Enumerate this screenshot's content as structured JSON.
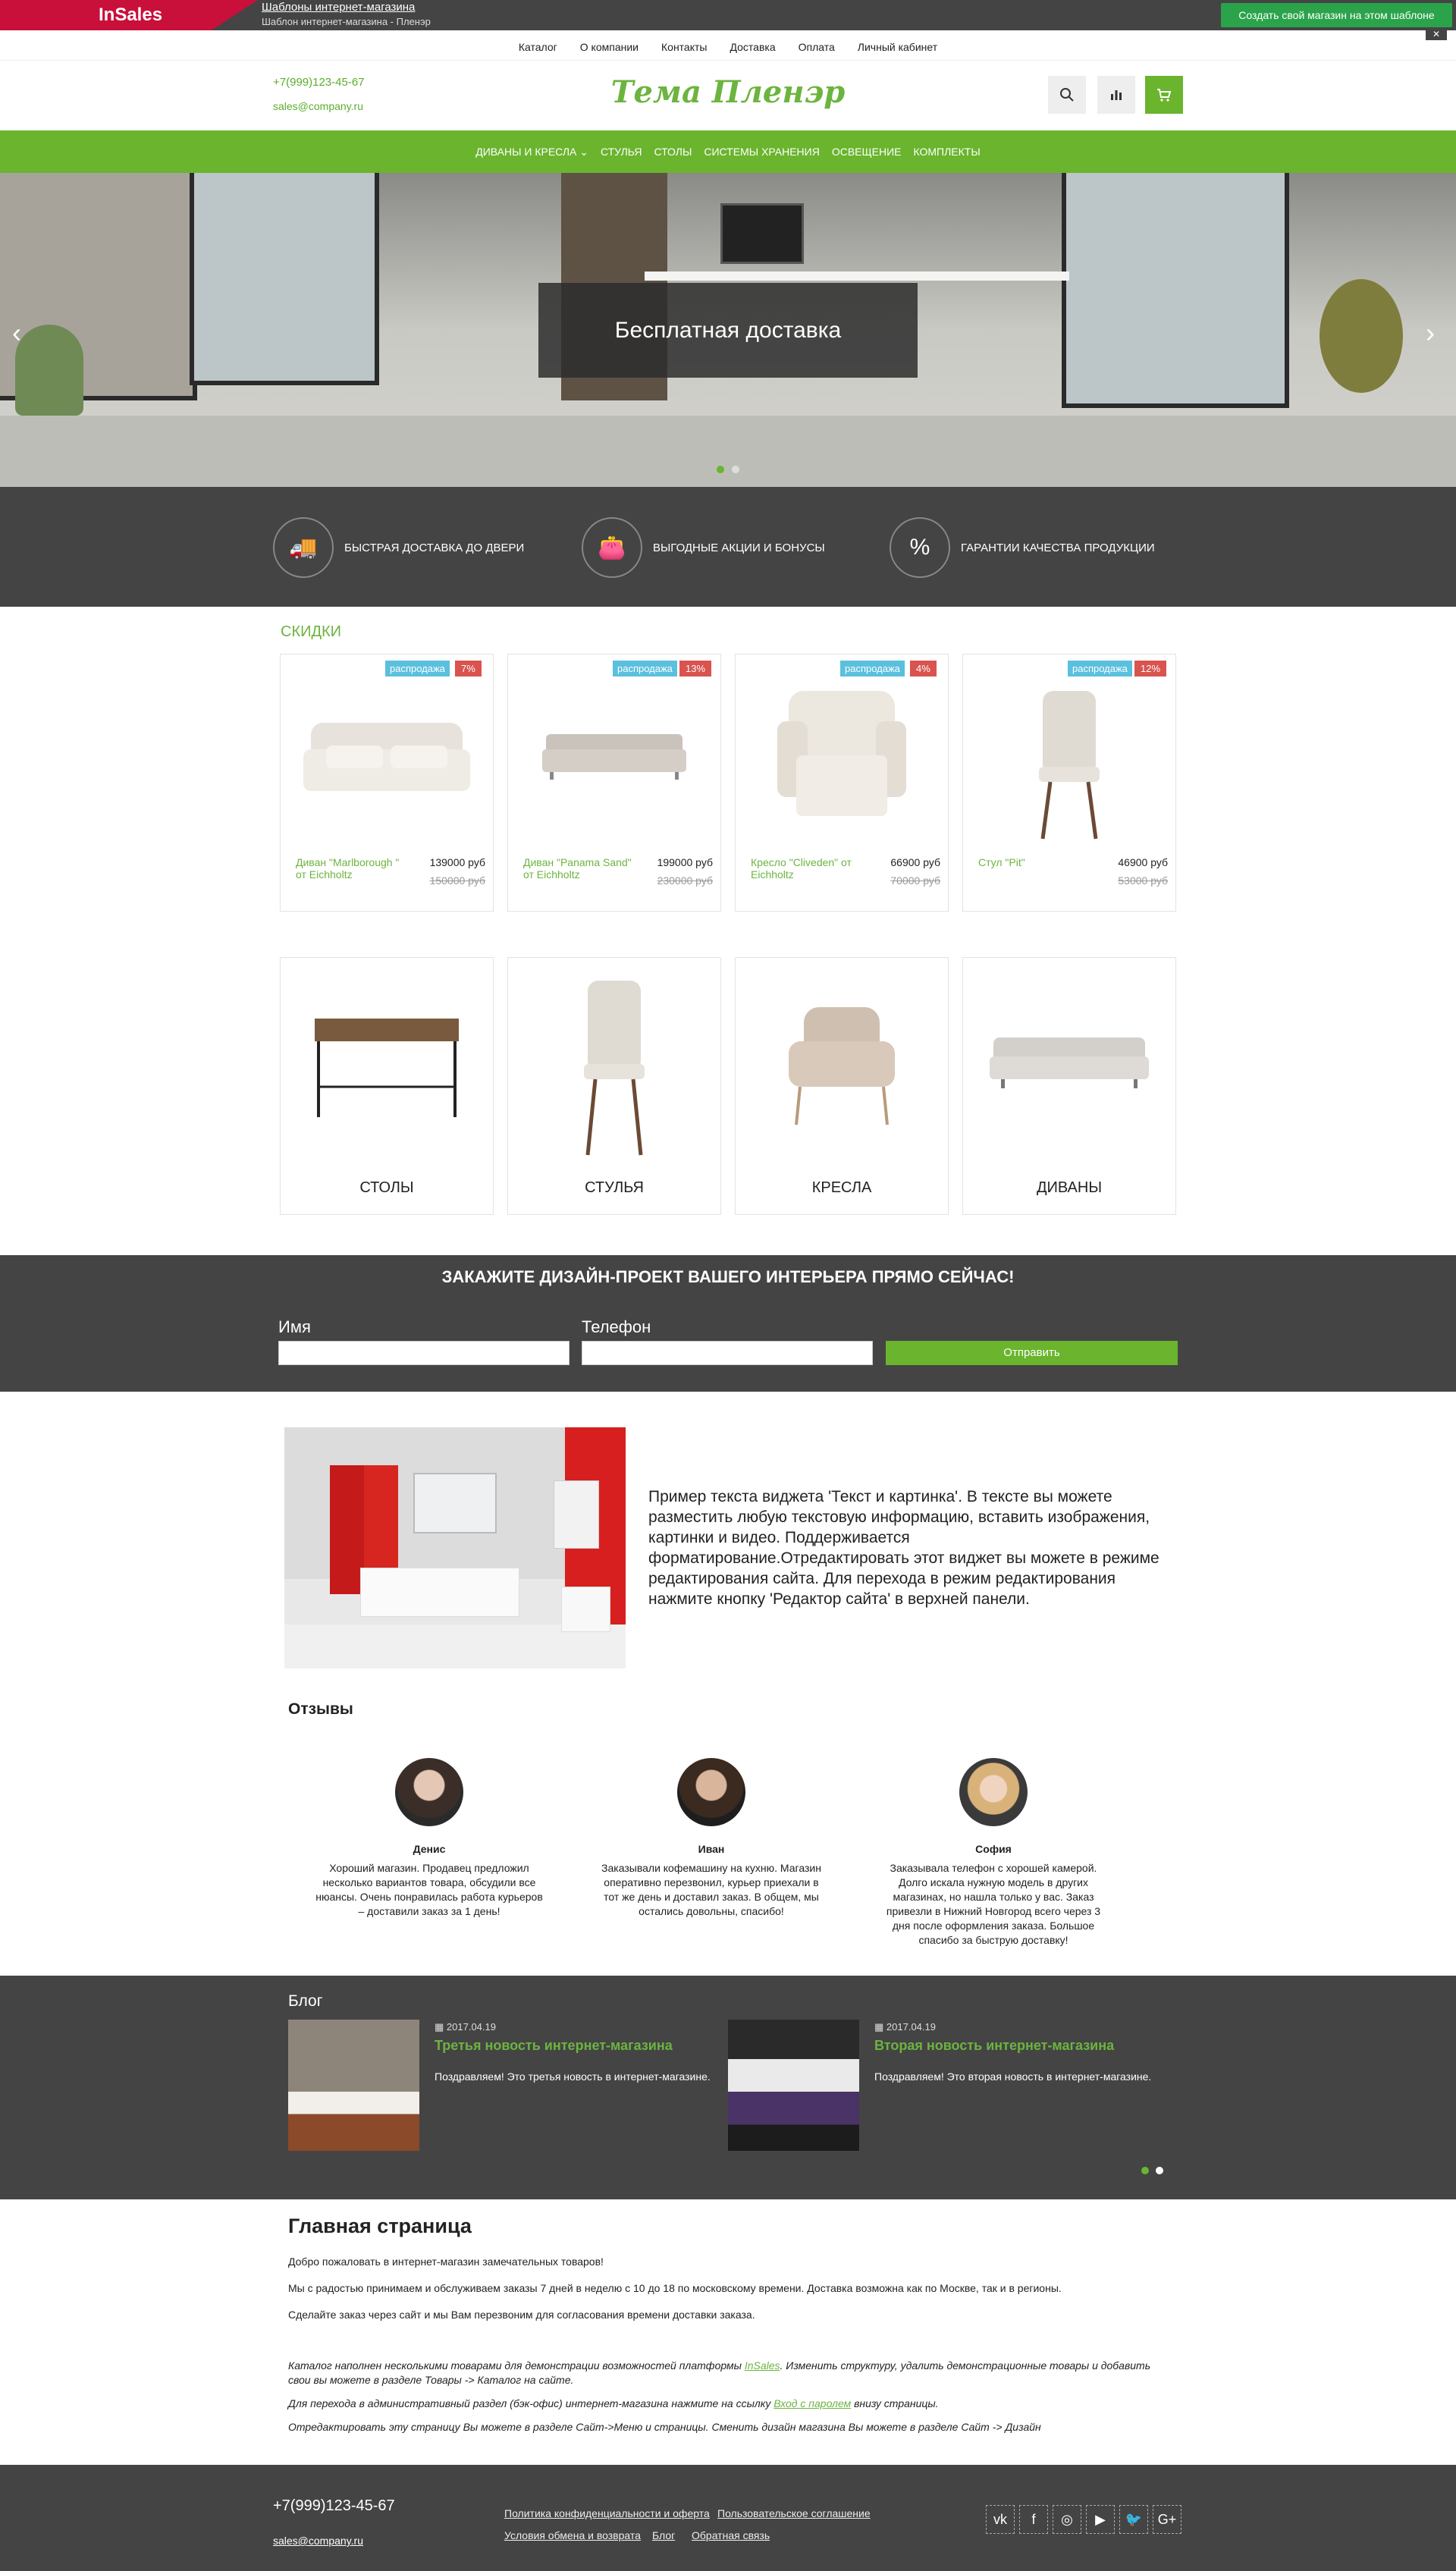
{
  "topbar": {
    "brand": "InSales",
    "link": "Шаблоны интернет-магазина",
    "subtitle": "Шаблон интернет-магазина - Пленэр",
    "create_btn": "Создать свой магазин на этом шаблоне",
    "close": "✕"
  },
  "topnav": [
    "Каталог",
    "О компании",
    "Контакты",
    "Доставка",
    "Оплата",
    "Личный кабинет"
  ],
  "header": {
    "phone": "+7(999)123-45-67",
    "email": "sales@company.ru",
    "logo": "Тема Пленэр"
  },
  "mainnav": [
    "ДИВАНЫ И КРЕСЛА",
    "СТУЛЬЯ",
    "СТОЛЫ",
    "СИСТЕМЫ ХРАНЕНИЯ",
    "ОСВЕЩЕНИЕ",
    "КОМПЛЕКТЫ"
  ],
  "slider": {
    "banner": "Бесплатная доставка"
  },
  "features": [
    "БЫСТРАЯ ДОСТАВКА ДО ДВЕРИ",
    "ВЫГОДНЫЕ АКЦИИ И БОНУСЫ",
    "ГАРАНТИИ КАЧЕСТВА ПРОДУКЦИИ"
  ],
  "sale": {
    "title": "СКИДКИ",
    "badge": "распродажа",
    "products": [
      {
        "name": "Диван \"Marlborough \" от Eichholtz",
        "price": "139000 руб",
        "old": "150000 руб",
        "discount": "7%"
      },
      {
        "name": "Диван \"Panama Sand\" от Eichholtz",
        "price": "199000 руб",
        "old": "230000 руб",
        "discount": "13%"
      },
      {
        "name": "Кресло \"Cliveden\" от Eichholtz",
        "price": "66900 руб",
        "old": "70000 руб",
        "discount": "4%"
      },
      {
        "name": "Стул \"Pit\"",
        "price": "46900 руб",
        "old": "53000 руб",
        "discount": "12%"
      }
    ]
  },
  "categories": [
    "СТОЛЫ",
    "СТУЛЬЯ",
    "КРЕСЛА",
    "ДИВАНЫ"
  ],
  "order": {
    "title": "ЗАКАЖИТЕ ДИЗАЙН-ПРОЕКТ ВАШЕГО ИНТЕРЬЕРА ПРЯМО СЕЙЧАС!",
    "name_label": "Имя",
    "phone_label": "Телефон",
    "submit": "Отправить"
  },
  "widget": {
    "text": "Пример текста виджета 'Текст и картинка'. В тексте вы можете разместить любую текстовую информацию, вставить изображения, картинки и видео. Поддерживается форматирование.Отредактировать этот виджет вы можете в режиме редактирования сайта. Для перехода в режим редактирования нажмите кнопку 'Редактор сайта' в верхней панели."
  },
  "reviews": {
    "title": "Отзывы",
    "items": [
      {
        "name": "Денис",
        "text": "Хороший магазин. Продавец предложил несколько вариантов товара, обсудили все нюансы. Очень понравилась работа курьеров – доставили заказ за 1 день!"
      },
      {
        "name": "Иван",
        "text": "Заказывали кофемашину на кухню. Магазин оперативно перезвонил, курьер приехали в тот же день и доставил заказ. В общем, мы остались довольны, спасибо!"
      },
      {
        "name": "София",
        "text": "Заказывала телефон с хорошей камерой. Долго искала нужную модель в других магазинах, но нашла только у вас. Заказ привезли в Нижний Новгород всего через 3 дня после оформления заказа. Большое спасибо за быструю доставку!"
      }
    ]
  },
  "blog": {
    "title": "Блог",
    "posts": [
      {
        "date": "2017.04.19",
        "title": "Третья новость интернет-магазина",
        "text": "Поздравляем! Это третья новость в интернет-магазине."
      },
      {
        "date": "2017.04.19",
        "title": "Вторая новость интернет-магазина",
        "text": "Поздравляем! Это вторая новость в интернет-магазине."
      }
    ]
  },
  "home": {
    "title": "Главная страница",
    "p1": "Добро пожаловать в интернет-магазин замечательных товаров!",
    "p2": "Мы с радостью принимаем и обслуживаем заказы 7 дней в неделю с 10 до 18 по московскому времени. Доставка возможна как по Москве, так и в регионы.",
    "p3": "Сделайте заказ через сайт и мы Вам перезвоним для согласования времени доставки заказа.",
    "i1a": "Каталог наполнен несколькими товарами для демонстрации возможностей платформы ",
    "i1link": "InSales",
    "i1b": ". Изменить структуру, удалить демонстрационные товары и добавить свои вы можете в разделе Товары -> Каталог на сайте.",
    "i2a": "Для перехода в административный раздел (бэк-офис) интернет-магазина нажмите на ссылку ",
    "i2link": "Вход с паролем",
    "i2b": " внизу страницы.",
    "i3": "Отредактировать эту страницу Вы можете в разделе Сайт->Меню и страницы. Сменить дизайн магазина Вы можете в разделе Сайт -> Дизайн"
  },
  "footer": {
    "phone": "+7(999)123-45-67",
    "email": "sales@company.ru",
    "links": [
      "Политика конфиденциальности и оферта",
      "Пользовательское соглашение",
      "Условия обмена и возврата",
      "Блог",
      "Обратная связь"
    ],
    "social": [
      "vk",
      "f",
      "ig",
      "yt",
      "tw",
      "G+"
    ]
  },
  "colors": {
    "accent": "#6ab42e",
    "dark": "#444444",
    "brand": "#c8103a"
  }
}
